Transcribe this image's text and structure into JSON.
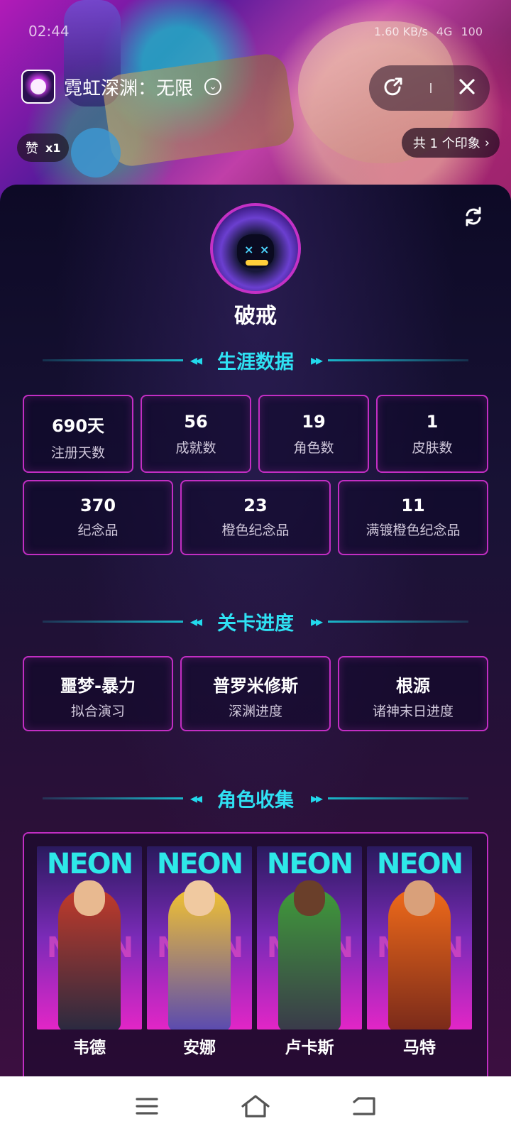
{
  "status": {
    "time": "02:44",
    "network": "1.60 KB/s",
    "signal": "4G",
    "battery": "100"
  },
  "header": {
    "title": "霓虹深渊：无限",
    "chevron": "⌄",
    "like_label": "赞",
    "like_count": "x1",
    "impressions": "共 1 个印象",
    "impressions_chevron": "›"
  },
  "profile": {
    "name": "破戒"
  },
  "sections": {
    "career": "生涯数据",
    "progress": "关卡进度",
    "collection": "角色收集"
  },
  "career_stats": [
    {
      "value": "690天",
      "label": "注册天数"
    },
    {
      "value": "56",
      "label": "成就数"
    },
    {
      "value": "19",
      "label": "角色数"
    },
    {
      "value": "1",
      "label": "皮肤数"
    },
    {
      "value": "370",
      "label": "纪念品"
    },
    {
      "value": "23",
      "label": "橙色纪念品"
    },
    {
      "value": "11",
      "label": "满镀橙色纪念品"
    }
  ],
  "progress_stats": [
    {
      "value": "噩梦-暴力",
      "label": "拟合演习"
    },
    {
      "value": "普罗米修斯",
      "label": "深渊进度"
    },
    {
      "value": "根源",
      "label": "诸神末日进度"
    }
  ],
  "characters": [
    {
      "name": "韦德",
      "banner": "NEON",
      "banner2": "NEON"
    },
    {
      "name": "安娜",
      "banner": "NEON",
      "banner2": "NEON"
    },
    {
      "name": "卢卡斯",
      "banner": "NEON",
      "banner2": "NEON"
    },
    {
      "name": "马特",
      "banner": "NEON",
      "banner2": "NEON"
    }
  ],
  "colors": {
    "accent_cyan": "#2fe1f3",
    "card_border": "#c22ec3",
    "bg_dark": "#0d0a26"
  }
}
